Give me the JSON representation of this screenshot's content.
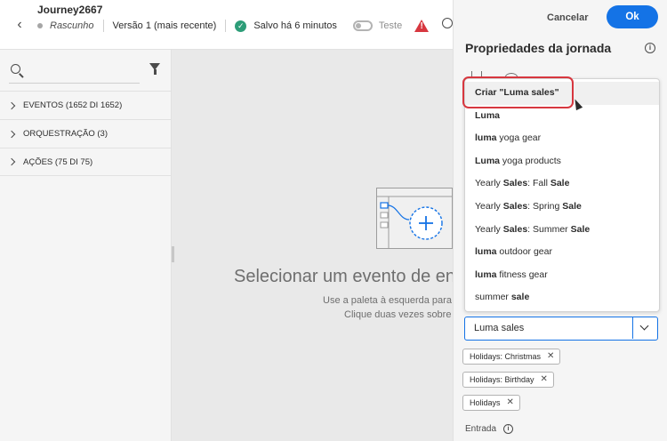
{
  "header": {
    "journey_name": "Journey2667",
    "status": "Rascunho",
    "version": "Versão 1 (mais recente)",
    "saved": "Salvo há 6 minutos",
    "test_label": "Teste"
  },
  "palette": {
    "items": [
      {
        "label": "EVENTOS (1652 DI 1652)"
      },
      {
        "label": "ORQUESTRAÇÃO (3)"
      },
      {
        "label": "AÇÕES (75 DI 75)"
      }
    ]
  },
  "canvas": {
    "empty_title": "Selecionar um evento de en",
    "empty_desc_1": "Use a paleta à esquerda para sele",
    "empty_desc_2": "Clique duas vezes sobre ele"
  },
  "panel": {
    "cancel_label": "Cancelar",
    "ok_label": "Ok",
    "title": "Propriedades da jornada",
    "dropdown_options": [
      {
        "pre": "Criar \"Luma sales\"",
        "bold": "",
        "post": ""
      },
      {
        "pre": "",
        "bold": "Luma",
        "post": ""
      },
      {
        "pre": "",
        "bold": "luma",
        "post": " yoga gear"
      },
      {
        "pre": "",
        "bold": "Luma",
        "post": " yoga products"
      },
      {
        "pre": "Yearly ",
        "bold": "Sales",
        "post": ": Fall ",
        "bold2": "Sale"
      },
      {
        "pre": "Yearly ",
        "bold": "Sales",
        "post": ": Spring ",
        "bold2": "Sale"
      },
      {
        "pre": "Yearly ",
        "bold": "Sales",
        "post": ": Summer ",
        "bold2": "Sale"
      },
      {
        "pre": "",
        "bold": "luma",
        "post": " outdoor gear"
      },
      {
        "pre": "",
        "bold": "luma",
        "post": " fitness gear"
      },
      {
        "pre": "summer ",
        "bold": "sale",
        "post": ""
      }
    ],
    "combo_value": "Luma sales",
    "tags": [
      {
        "label": "Holidays: Christmas"
      },
      {
        "label": "Holidays: Birthday"
      },
      {
        "label": "Holidays"
      }
    ],
    "entry_label": "Entrada"
  }
}
